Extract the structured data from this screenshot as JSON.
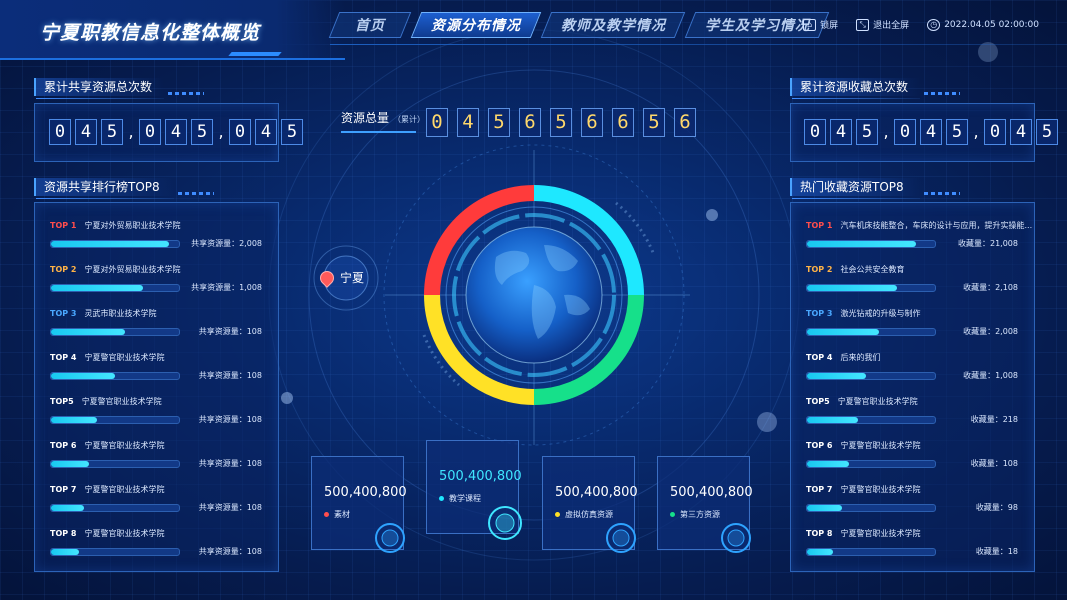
{
  "header": {
    "title": "宁夏职教信息化整体概览",
    "nav": [
      {
        "label": "首页",
        "active": false
      },
      {
        "label": "资源分布情况",
        "active": true
      },
      {
        "label": "教师及教学情况",
        "active": false
      },
      {
        "label": "学生及学习情况",
        "active": false
      }
    ],
    "tools": {
      "lock": "锁屏",
      "exit_fullscreen": "退出全屏",
      "datetime": "2022.04.05 02:00:00"
    }
  },
  "left": {
    "share_total_title": "累计共享资源总次数",
    "share_total_digits": [
      "0",
      "4",
      "5",
      ",",
      "0",
      "4",
      "5",
      ",",
      "0",
      "4",
      "5"
    ],
    "ranking_title": "资源共享排行榜TOP8",
    "ranking": [
      {
        "tag": "TOP 1",
        "color": "#ff4d4d",
        "name": "宁夏对外贸易职业技术学院",
        "value_text": "共享资源量：2,008",
        "level": 0.92
      },
      {
        "tag": "TOP 2",
        "color": "#ffb347",
        "name": "宁夏对外贸易职业技术学院",
        "value_text": "共享资源量：1,008",
        "level": 0.72
      },
      {
        "tag": "TOP 3",
        "color": "#4aa8ff",
        "name": "灵武市职业技术学院",
        "value_text": "共享资源量：108",
        "level": 0.58
      },
      {
        "tag": "TOP 4",
        "color": "#ffffff",
        "name": "宁夏警官职业技术学院",
        "value_text": "共享资源量：108",
        "level": 0.5
      },
      {
        "tag": "TOP5",
        "color": "#ffffff",
        "name": "宁夏警官职业技术学院",
        "value_text": "共享资源量：108",
        "level": 0.36
      },
      {
        "tag": "TOP 6",
        "color": "#ffffff",
        "name": "宁夏警官职业技术学院",
        "value_text": "共享资源量：108",
        "level": 0.3
      },
      {
        "tag": "TOP 7",
        "color": "#ffffff",
        "name": "宁夏警官职业技术学院",
        "value_text": "共享资源量：108",
        "level": 0.26
      },
      {
        "tag": "TOP 8",
        "color": "#ffffff",
        "name": "宁夏警官职业技术学院",
        "value_text": "共享资源量：108",
        "level": 0.22
      }
    ]
  },
  "center": {
    "total_label": "资源总量",
    "total_suffix": "（累计）",
    "total_digits": [
      "0",
      "4",
      "5",
      "6",
      "5",
      "6",
      "6",
      "5",
      "6"
    ],
    "location": "宁夏",
    "ring_colors": {
      "top_right": "#1ee8ff",
      "bottom_right": "#16e08a",
      "bottom_left": "#ffe126",
      "top_left": "#ff3b3b"
    },
    "stats": [
      {
        "value": "500,400,800",
        "name": "素材",
        "dot": "#ff4d4d"
      },
      {
        "value": "500,400,800",
        "name": "教学课程",
        "dot": "#1ee8ff"
      },
      {
        "value": "500,400,800",
        "name": "虚拟仿真资源",
        "dot": "#ffe126"
      },
      {
        "value": "500,400,800",
        "name": "第三方资源",
        "dot": "#16e08a"
      }
    ]
  },
  "right": {
    "collect_total_title": "累计资源收藏总次数",
    "collect_total_digits": [
      "0",
      "4",
      "5",
      ",",
      "0",
      "4",
      "5",
      ",",
      "0",
      "4",
      "5"
    ],
    "ranking_title": "热门收藏资源TOP8",
    "ranking": [
      {
        "tag": "TOP 1",
        "color": "#ff4d4d",
        "name": "汽车机床技能整合，车床的设计与应用，提升实操能...",
        "value_text": "收藏量：21,008",
        "level": 0.85
      },
      {
        "tag": "TOP 2",
        "color": "#ffb347",
        "name": "社会公共安全教育",
        "value_text": "收藏量：2,108",
        "level": 0.7
      },
      {
        "tag": "TOP 3",
        "color": "#4aa8ff",
        "name": "激光钻戒的升级与制作",
        "value_text": "收藏量：2,008",
        "level": 0.56
      },
      {
        "tag": "TOP 4",
        "color": "#ffffff",
        "name": "后来的我们",
        "value_text": "收藏量：1,008",
        "level": 0.46
      },
      {
        "tag": "TOP5",
        "color": "#ffffff",
        "name": "宁夏警官职业技术学院",
        "value_text": "收藏量：218",
        "level": 0.4
      },
      {
        "tag": "TOP 6",
        "color": "#ffffff",
        "name": "宁夏警官职业技术学院",
        "value_text": "收藏量：108",
        "level": 0.33
      },
      {
        "tag": "TOP 7",
        "color": "#ffffff",
        "name": "宁夏警官职业技术学院",
        "value_text": "收藏量：98",
        "level": 0.27
      },
      {
        "tag": "TOP 8",
        "color": "#ffffff",
        "name": "宁夏警官职业技术学院",
        "value_text": "收藏量：18",
        "level": 0.2
      }
    ]
  }
}
